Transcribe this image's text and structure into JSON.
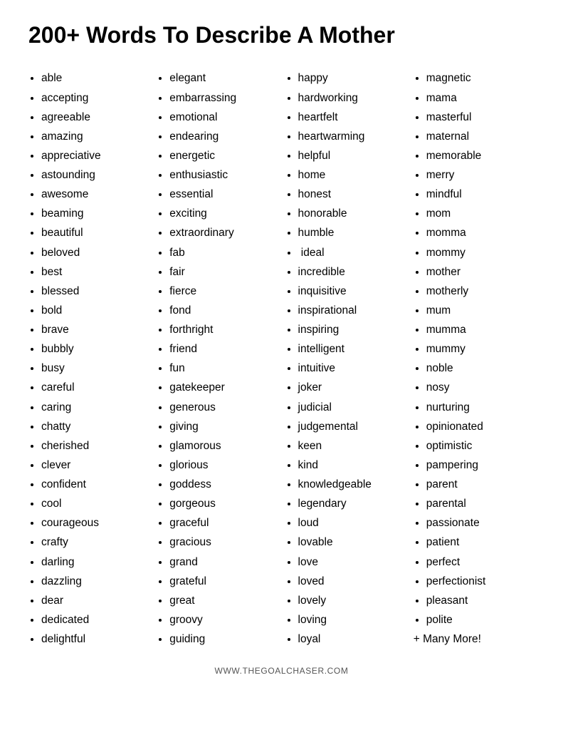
{
  "title": "200+ Words To Describe A Mother",
  "columns": [
    {
      "id": "col1",
      "words": [
        "able",
        "accepting",
        "agreeable",
        "amazing",
        "appreciative",
        "astounding",
        "awesome",
        "beaming",
        "beautiful",
        "beloved",
        "best",
        "blessed",
        "bold",
        "brave",
        "bubbly",
        "busy",
        "careful",
        "caring",
        "chatty",
        "cherished",
        "clever",
        "confident",
        "cool",
        "courageous",
        "crafty",
        "darling",
        "dazzling",
        "dear",
        "dedicated",
        "delightful"
      ]
    },
    {
      "id": "col2",
      "words": [
        "elegant",
        "embarrassing",
        "emotional",
        "endearing",
        "energetic",
        "enthusiastic",
        "essential",
        "exciting",
        "extraordinary",
        "fab",
        "fair",
        "fierce",
        "fond",
        "forthright",
        "friend",
        "fun",
        "gatekeeper",
        "generous",
        "giving",
        "glamorous",
        "glorious",
        "goddess",
        "gorgeous",
        "graceful",
        "gracious",
        "grand",
        "grateful",
        "great",
        "groovy",
        "guiding"
      ]
    },
    {
      "id": "col3",
      "words": [
        "happy",
        "hardworking",
        "heartfelt",
        "heartwarming",
        "helpful",
        "home",
        "honest",
        "honorable",
        "humble",
        " ideal",
        "incredible",
        "inquisitive",
        "inspirational",
        "inspiring",
        "intelligent",
        "intuitive",
        "joker",
        "judicial",
        "judgemental",
        "keen",
        "kind",
        "knowledgeable",
        "legendary",
        "loud",
        "lovable",
        "love",
        "loved",
        "lovely",
        "loving",
        "loyal"
      ]
    },
    {
      "id": "col4",
      "words": [
        "magnetic",
        "mama",
        "masterful",
        "maternal",
        "memorable",
        "merry",
        "mindful",
        "mom",
        "momma",
        "mommy",
        "mother",
        "motherly",
        "mum",
        "mumma",
        "mummy",
        "noble",
        "nosy",
        "nurturing",
        "opinionated",
        "optimistic",
        "pampering",
        "parent",
        "parental",
        "passionate",
        "patient",
        "perfect",
        "perfectionist",
        "pleasant",
        "polite"
      ],
      "extra": "+ Many More!"
    }
  ],
  "footer": "WWW.THEGOALCHASER.COM"
}
